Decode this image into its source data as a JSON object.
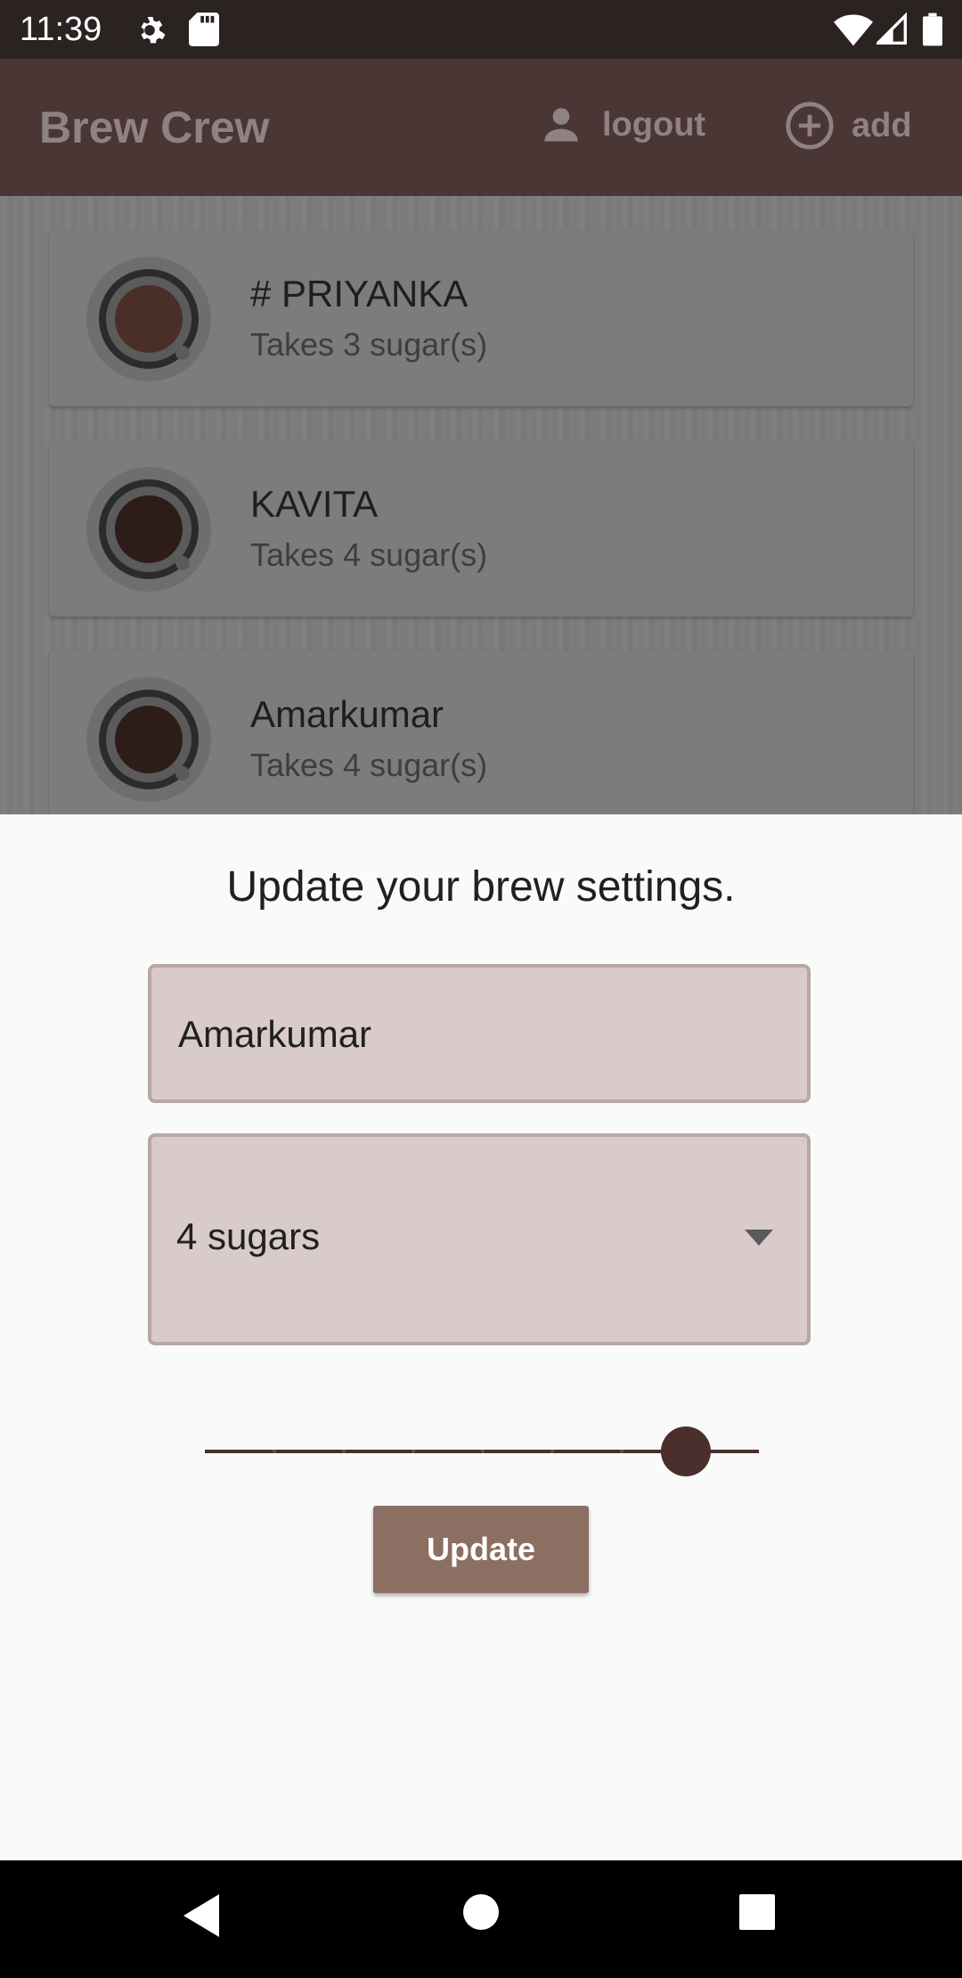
{
  "status_bar": {
    "time": "11:39",
    "icons": [
      "gear-icon",
      "sd-card-icon",
      "wifi-icon",
      "signal-icon",
      "battery-icon"
    ]
  },
  "app_bar": {
    "title": "Brew Crew",
    "logout_label": "logout",
    "add_label": "add"
  },
  "brews": [
    {
      "name": "# PRIYANKA",
      "subtitle": "Takes 3 sugar(s)",
      "cup_color": "#4a2f28"
    },
    {
      "name": "KAVITA",
      "subtitle": "Takes 4 sugar(s)",
      "cup_color": "#2e1c18"
    },
    {
      "name": "Amarkumar",
      "subtitle": "Takes 4 sugar(s)",
      "cup_color": "#2e1c18"
    }
  ],
  "sheet": {
    "title": "Update your brew settings.",
    "name_value": "Amarkumar",
    "sugar_value": "4 sugars",
    "strength_level": 0.875,
    "update_label": "Update"
  },
  "colors": {
    "accent": "#8d6e63",
    "field_fill": "#d8cbc9",
    "slider": "#4a2f2c"
  }
}
